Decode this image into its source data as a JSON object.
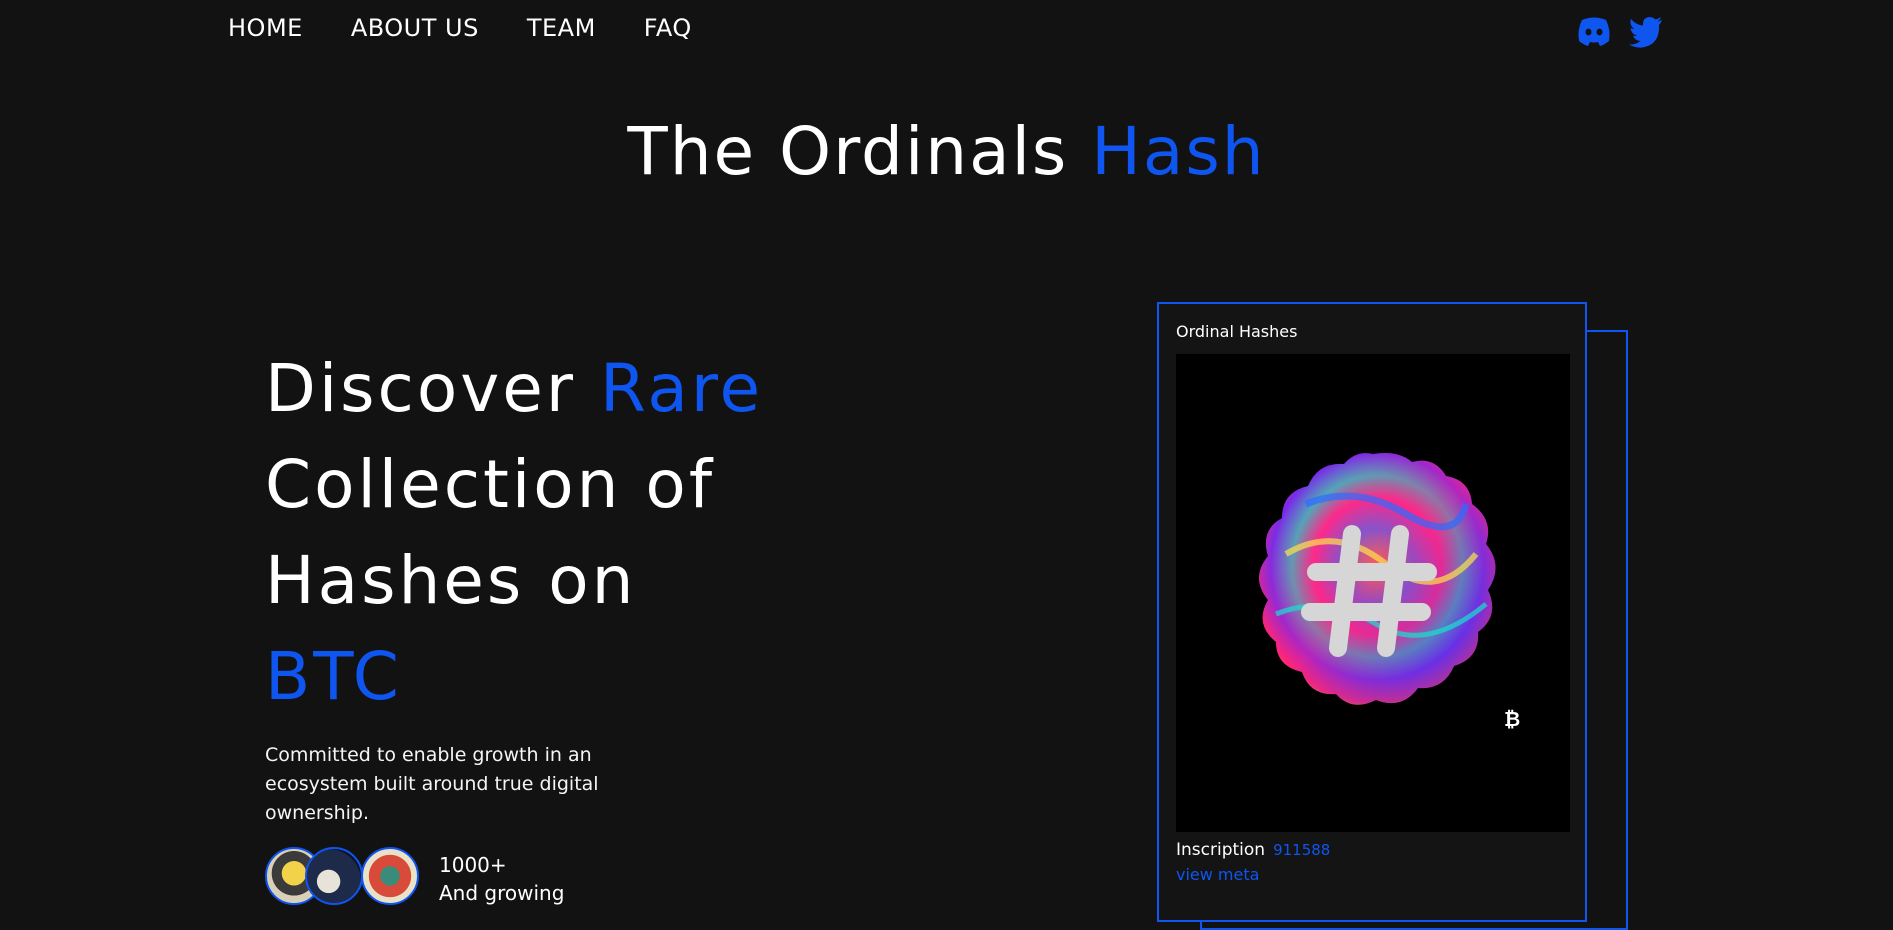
{
  "nav": {
    "items": [
      {
        "label": "HOME"
      },
      {
        "label": "ABOUT US"
      },
      {
        "label": "TEAM"
      },
      {
        "label": "FAQ"
      }
    ],
    "social": [
      "discord-icon",
      "twitter-icon"
    ]
  },
  "site_title": {
    "main": "The Ordinals ",
    "accent": "Hash"
  },
  "hero": {
    "line1_a": "Discover ",
    "line1_b": "Rare",
    "line2": "Collection of",
    "line3": "Hashes on",
    "line4": "BTC",
    "subtitle": "Committed to enable growth in an ecosystem built around true digital ownership.",
    "community_count": "1000+",
    "community_label": "And growing"
  },
  "card": {
    "title": "Ordinal Hashes",
    "inscription_label": "Inscription",
    "inscription_number": "911588",
    "view_meta": "view meta",
    "art_symbol": "#",
    "art_badge": "₿"
  },
  "colors": {
    "background": "#121212",
    "accent": "#0f55f0",
    "text": "#ffffff"
  }
}
